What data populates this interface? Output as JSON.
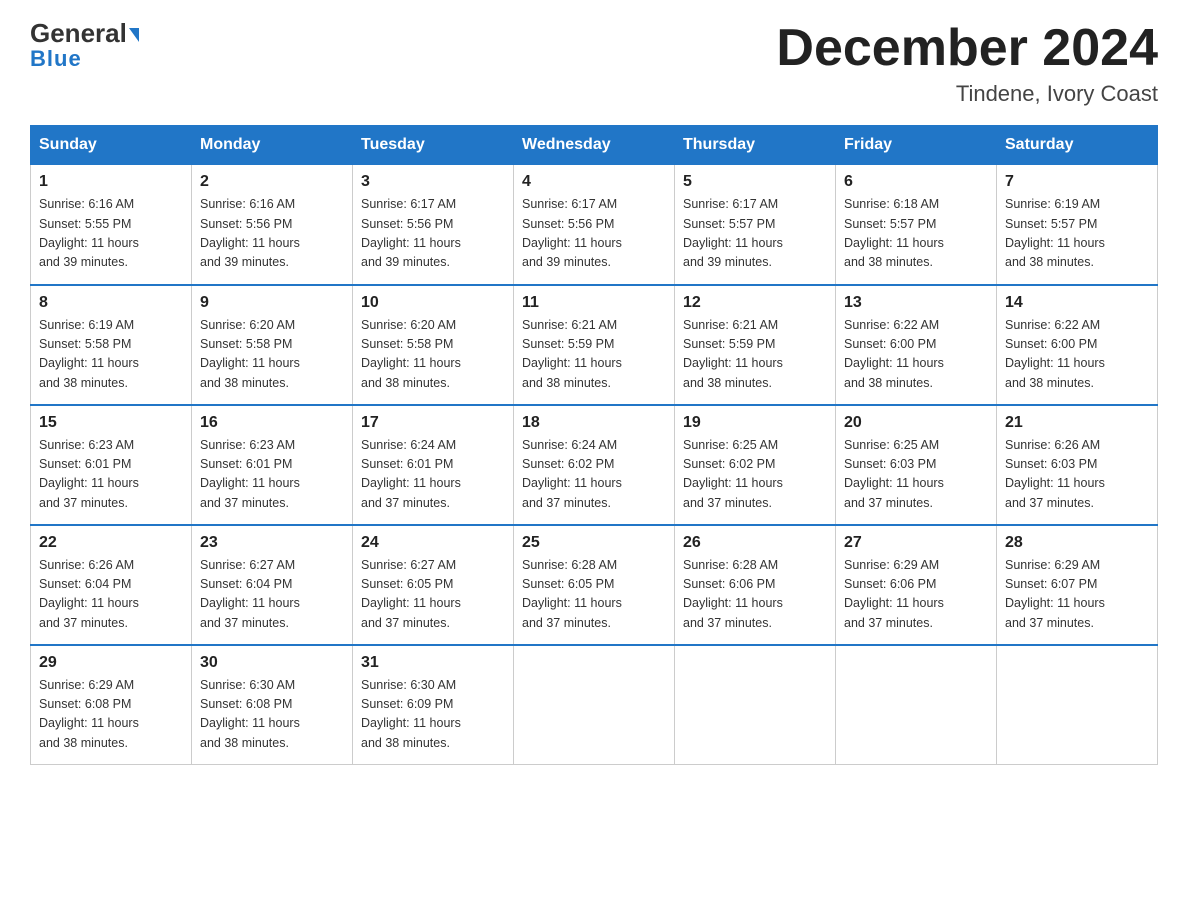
{
  "header": {
    "logo_line1a": "General",
    "logo_line1b": "Blue",
    "month_title": "December 2024",
    "location": "Tindene, Ivory Coast"
  },
  "days_of_week": [
    "Sunday",
    "Monday",
    "Tuesday",
    "Wednesday",
    "Thursday",
    "Friday",
    "Saturday"
  ],
  "weeks": [
    [
      {
        "day": "1",
        "sunrise": "6:16 AM",
        "sunset": "5:55 PM",
        "daylight": "11 hours and 39 minutes."
      },
      {
        "day": "2",
        "sunrise": "6:16 AM",
        "sunset": "5:56 PM",
        "daylight": "11 hours and 39 minutes."
      },
      {
        "day": "3",
        "sunrise": "6:17 AM",
        "sunset": "5:56 PM",
        "daylight": "11 hours and 39 minutes."
      },
      {
        "day": "4",
        "sunrise": "6:17 AM",
        "sunset": "5:56 PM",
        "daylight": "11 hours and 39 minutes."
      },
      {
        "day": "5",
        "sunrise": "6:17 AM",
        "sunset": "5:57 PM",
        "daylight": "11 hours and 39 minutes."
      },
      {
        "day": "6",
        "sunrise": "6:18 AM",
        "sunset": "5:57 PM",
        "daylight": "11 hours and 38 minutes."
      },
      {
        "day": "7",
        "sunrise": "6:19 AM",
        "sunset": "5:57 PM",
        "daylight": "11 hours and 38 minutes."
      }
    ],
    [
      {
        "day": "8",
        "sunrise": "6:19 AM",
        "sunset": "5:58 PM",
        "daylight": "11 hours and 38 minutes."
      },
      {
        "day": "9",
        "sunrise": "6:20 AM",
        "sunset": "5:58 PM",
        "daylight": "11 hours and 38 minutes."
      },
      {
        "day": "10",
        "sunrise": "6:20 AM",
        "sunset": "5:58 PM",
        "daylight": "11 hours and 38 minutes."
      },
      {
        "day": "11",
        "sunrise": "6:21 AM",
        "sunset": "5:59 PM",
        "daylight": "11 hours and 38 minutes."
      },
      {
        "day": "12",
        "sunrise": "6:21 AM",
        "sunset": "5:59 PM",
        "daylight": "11 hours and 38 minutes."
      },
      {
        "day": "13",
        "sunrise": "6:22 AM",
        "sunset": "6:00 PM",
        "daylight": "11 hours and 38 minutes."
      },
      {
        "day": "14",
        "sunrise": "6:22 AM",
        "sunset": "6:00 PM",
        "daylight": "11 hours and 38 minutes."
      }
    ],
    [
      {
        "day": "15",
        "sunrise": "6:23 AM",
        "sunset": "6:01 PM",
        "daylight": "11 hours and 37 minutes."
      },
      {
        "day": "16",
        "sunrise": "6:23 AM",
        "sunset": "6:01 PM",
        "daylight": "11 hours and 37 minutes."
      },
      {
        "day": "17",
        "sunrise": "6:24 AM",
        "sunset": "6:01 PM",
        "daylight": "11 hours and 37 minutes."
      },
      {
        "day": "18",
        "sunrise": "6:24 AM",
        "sunset": "6:02 PM",
        "daylight": "11 hours and 37 minutes."
      },
      {
        "day": "19",
        "sunrise": "6:25 AM",
        "sunset": "6:02 PM",
        "daylight": "11 hours and 37 minutes."
      },
      {
        "day": "20",
        "sunrise": "6:25 AM",
        "sunset": "6:03 PM",
        "daylight": "11 hours and 37 minutes."
      },
      {
        "day": "21",
        "sunrise": "6:26 AM",
        "sunset": "6:03 PM",
        "daylight": "11 hours and 37 minutes."
      }
    ],
    [
      {
        "day": "22",
        "sunrise": "6:26 AM",
        "sunset": "6:04 PM",
        "daylight": "11 hours and 37 minutes."
      },
      {
        "day": "23",
        "sunrise": "6:27 AM",
        "sunset": "6:04 PM",
        "daylight": "11 hours and 37 minutes."
      },
      {
        "day": "24",
        "sunrise": "6:27 AM",
        "sunset": "6:05 PM",
        "daylight": "11 hours and 37 minutes."
      },
      {
        "day": "25",
        "sunrise": "6:28 AM",
        "sunset": "6:05 PM",
        "daylight": "11 hours and 37 minutes."
      },
      {
        "day": "26",
        "sunrise": "6:28 AM",
        "sunset": "6:06 PM",
        "daylight": "11 hours and 37 minutes."
      },
      {
        "day": "27",
        "sunrise": "6:29 AM",
        "sunset": "6:06 PM",
        "daylight": "11 hours and 37 minutes."
      },
      {
        "day": "28",
        "sunrise": "6:29 AM",
        "sunset": "6:07 PM",
        "daylight": "11 hours and 37 minutes."
      }
    ],
    [
      {
        "day": "29",
        "sunrise": "6:29 AM",
        "sunset": "6:08 PM",
        "daylight": "11 hours and 38 minutes."
      },
      {
        "day": "30",
        "sunrise": "6:30 AM",
        "sunset": "6:08 PM",
        "daylight": "11 hours and 38 minutes."
      },
      {
        "day": "31",
        "sunrise": "6:30 AM",
        "sunset": "6:09 PM",
        "daylight": "11 hours and 38 minutes."
      },
      null,
      null,
      null,
      null
    ]
  ],
  "labels": {
    "sunrise": "Sunrise:",
    "sunset": "Sunset:",
    "daylight": "Daylight:"
  }
}
